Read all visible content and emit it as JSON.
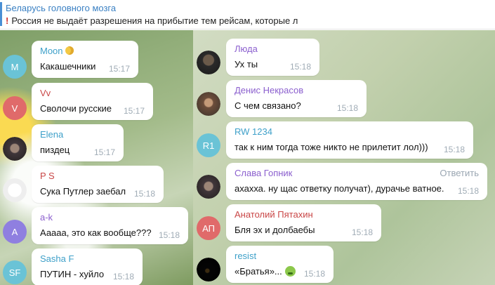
{
  "pinned": {
    "title": "Беларусь головного мозга",
    "text": "Россия не выдаёт разрешения на прибытие тем рейсам, которые л",
    "icon": "exclamation-icon"
  },
  "left_messages": [
    {
      "avatar_initial": "M",
      "avatar_color": "#6ac3d6",
      "name": "Moon",
      "name_color": "#3ea0c9",
      "text": "Какашечники",
      "time": "15:17"
    },
    {
      "avatar_initial": "V",
      "avatar_color": "#e06a6a",
      "name": "Vv",
      "name_color": "#c94646",
      "text": "Сволочи русские",
      "time": "15:17"
    },
    {
      "avatar_initial": "",
      "avatar_color": "#555555",
      "name": "Elena",
      "name_color": "#3ea0c9",
      "text": "пиздец",
      "time": "15:17"
    },
    {
      "avatar_initial": "",
      "avatar_color": "#ffffff",
      "name": "P S",
      "name_color": "#c94646",
      "text": "Сука Путлер заебал",
      "time": "15:18"
    },
    {
      "avatar_initial": "A",
      "avatar_color": "#8f7fe0",
      "name": "a-k",
      "name_color": "#8b5fce",
      "text": "Ааааа, это как вообще???",
      "time": "15:18"
    },
    {
      "avatar_initial": "SF",
      "avatar_color": "#6ac3d6",
      "name": "Sasha F",
      "name_color": "#3ea0c9",
      "text": "ПУТИН - хуйло",
      "time": "15:18"
    }
  ],
  "right_messages": [
    {
      "avatar_initial": "",
      "avatar_color": "#3a3a3a",
      "name": "Люда",
      "name_color": "#8b5fce",
      "text": "Ух ты",
      "time": "15:18"
    },
    {
      "avatar_initial": "",
      "avatar_color": "#6c4d3a",
      "name": "Денис Некрасов",
      "name_color": "#8b5fce",
      "text": "С чем связано?",
      "time": "15:18"
    },
    {
      "avatar_initial": "R1",
      "avatar_color": "#6ac3d6",
      "name": "RW 1234",
      "name_color": "#3ea0c9",
      "text": "так к ним тогда тоже никто не прилетит лол)))",
      "time": "15:18"
    },
    {
      "avatar_initial": "",
      "avatar_color": "#40363a",
      "name": "Слава Гопник",
      "name_color": "#8b5fce",
      "text": "ахахха. ну щас ответку получат), дурачье ватное.",
      "time": "15:18",
      "reply": "Ответить"
    },
    {
      "avatar_initial": "АП",
      "avatar_color": "#e06a6a",
      "name": "Анатолий Пятахин",
      "name_color": "#c94646",
      "text": "Бля эх и долбаебы",
      "time": "15:18"
    },
    {
      "avatar_initial": "",
      "avatar_color": "#000000",
      "name": "resist",
      "name_color": "#3ea0c9",
      "text": "«Братья»...",
      "time": "15:18"
    }
  ]
}
